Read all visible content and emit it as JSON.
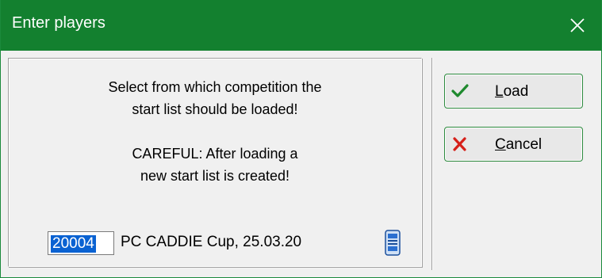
{
  "window": {
    "title": "Enter players",
    "close_label": "✕"
  },
  "message": {
    "line1": "Select from which competition the",
    "line2": "start list should be loaded!",
    "line3": "CAREFUL: After loading a",
    "line4": "new start list is created!"
  },
  "competition": {
    "number": "20004",
    "name": "PC CADDIE Cup, 25.03.20"
  },
  "buttons": {
    "load_mnemonic": "L",
    "load_rest": "oad",
    "cancel_mnemonic": "C",
    "cancel_rest": "ancel"
  },
  "colors": {
    "titlebar": "#13802f",
    "selection": "#0a62d2",
    "check": "#1f8a2e",
    "cross": "#d6201a"
  }
}
